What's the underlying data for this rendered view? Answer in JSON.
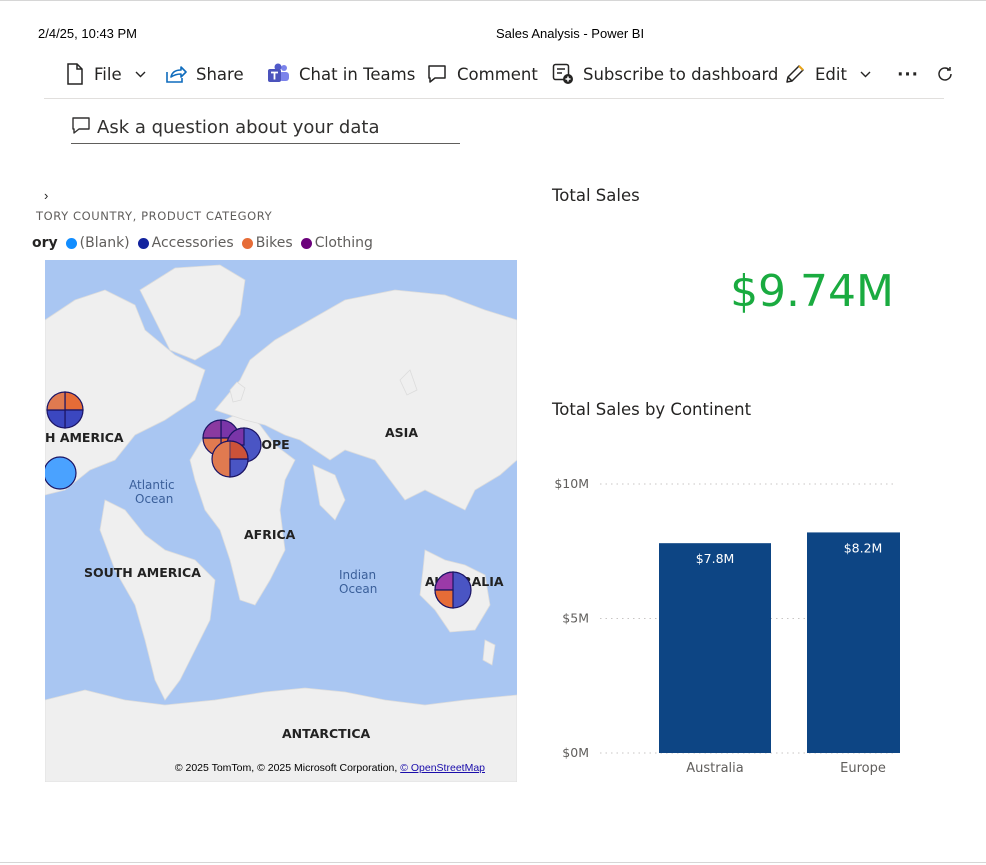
{
  "print_header": {
    "date": "2/4/25, 10:43 PM",
    "title": "Sales Analysis - Power BI"
  },
  "toolbar": {
    "file": "File",
    "share": "Share",
    "chat": "Chat in Teams",
    "comment": "Comment",
    "subscribe": "Subscribe to dashboard",
    "edit": "Edit",
    "more": "···"
  },
  "qa": {
    "placeholder": "Ask a question about your data"
  },
  "map_visual": {
    "title": "Total Sales by Territory Country, Product Category",
    "title_visible": "›",
    "subtitle": "TORY COUNTRY, PRODUCT CATEGORY",
    "legend_title": "ory",
    "legend": [
      {
        "label": "(Blank)",
        "color": "#118dff"
      },
      {
        "label": "Accessories",
        "color": "#12239e"
      },
      {
        "label": "Bikes",
        "color": "#e66c37"
      },
      {
        "label": "Clothing",
        "color": "#6b007b"
      }
    ],
    "labels": {
      "north_america": "H AMERICA",
      "europe": "EUROPE",
      "asia": "ASIA",
      "africa": "AFRICA",
      "south_america": "SOUTH AMERICA",
      "australia": "AUSTRALIA",
      "antarctica": "ANTARCTICA",
      "atlantic": "Atlantic",
      "ocean1": "Ocean",
      "indian": "Indian",
      "ocean2": "Ocean"
    },
    "copyright": "© 2025 TomTom, © 2025 Microsoft Corporation, ",
    "copyright_link": "© OpenStreetMap"
  },
  "card": {
    "title": "Total Sales",
    "value": "$9.74M"
  },
  "chart_data": {
    "type": "bar",
    "title": "Total Sales by Continent",
    "categories": [
      "Australia",
      "Europe"
    ],
    "values": [
      7.8,
      8.2
    ],
    "data_labels": [
      "$7.8M",
      "$8.2M"
    ],
    "y_ticks": [
      "$0M",
      "$5M",
      "$10M"
    ],
    "ylim": [
      0,
      10
    ],
    "unit": "M",
    "bar_color": "#0d4584",
    "grid": true
  }
}
